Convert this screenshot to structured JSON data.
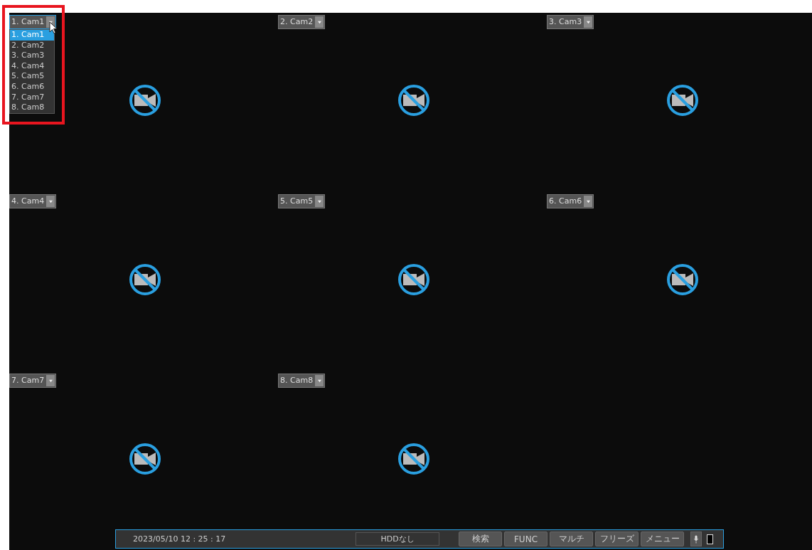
{
  "highlight_frame": true,
  "cameras": [
    {
      "label": "1. Cam1",
      "signal": false,
      "dropdown_open": true
    },
    {
      "label": "2. Cam2",
      "signal": false,
      "dropdown_open": false
    },
    {
      "label": "3. Cam3",
      "signal": false,
      "dropdown_open": false
    },
    {
      "label": "4. Cam4",
      "signal": false,
      "dropdown_open": false
    },
    {
      "label": "5. Cam5",
      "signal": false,
      "dropdown_open": false
    },
    {
      "label": "6. Cam6",
      "signal": false,
      "dropdown_open": false
    },
    {
      "label": "7. Cam7",
      "signal": false,
      "dropdown_open": false
    },
    {
      "label": "8. Cam8",
      "signal": false,
      "dropdown_open": false
    }
  ],
  "dropdown_options": [
    {
      "label": "1. Cam1",
      "selected": true
    },
    {
      "label": "2. Cam2",
      "selected": false
    },
    {
      "label": "3. Cam3",
      "selected": false
    },
    {
      "label": "4. Cam4",
      "selected": false
    },
    {
      "label": "5. Cam5",
      "selected": false
    },
    {
      "label": "6. Cam6",
      "selected": false
    },
    {
      "label": "7. Cam7",
      "selected": false
    },
    {
      "label": "8. Cam8",
      "selected": false
    }
  ],
  "status_bar": {
    "datetime": "2023/05/10  12 : 25 : 17",
    "hdd_status": "HDDなし",
    "buttons": [
      "検索",
      "FUNC",
      "マルチ",
      "フリーズ",
      "メニュー"
    ]
  }
}
